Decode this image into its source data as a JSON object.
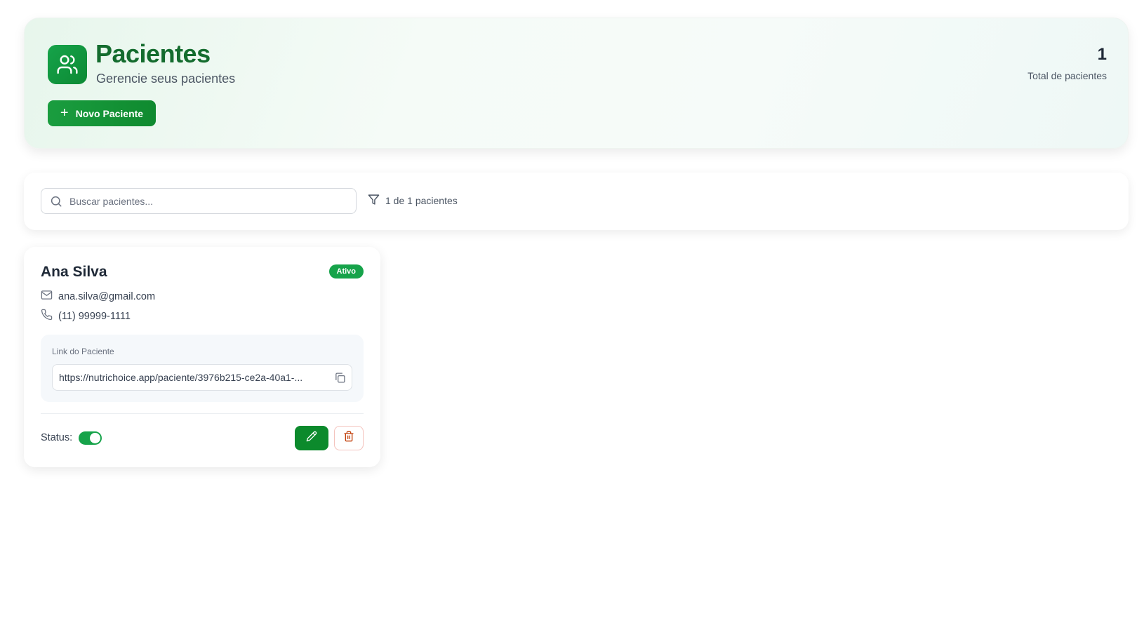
{
  "header": {
    "title": "Pacientes",
    "subtitle": "Gerencie seus pacientes",
    "new_button_label": "Novo Paciente",
    "total_count": "1",
    "total_label": "Total de pacientes",
    "icon": "users-icon",
    "accent_color": "#16a34a"
  },
  "search": {
    "placeholder": "Buscar pacientes...",
    "value": "",
    "result_count_text": "1 de 1 pacientes",
    "icon": "search-icon",
    "filter_icon": "filter-icon"
  },
  "patients": [
    {
      "name": "Ana Silva",
      "status_badge": "Ativo",
      "email": "ana.silva@gmail.com",
      "phone": "(11) 99999-1111",
      "link_label": "Link do Paciente",
      "link": "https://nutrichoice.app/paciente/3976b215-ce2a-40a1-...",
      "status_label": "Status:",
      "status_active": true,
      "badge_color": "#16a34a",
      "delete_color": "#c2410c"
    }
  ]
}
